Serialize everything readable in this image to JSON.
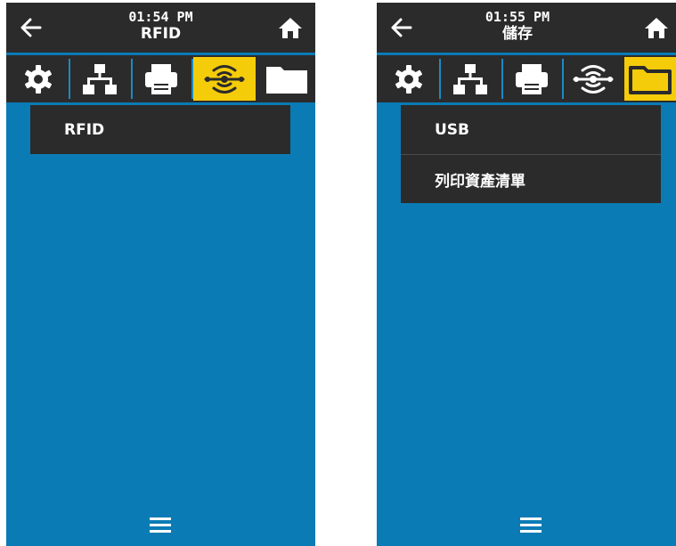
{
  "screens": [
    {
      "time": "01:54 PM",
      "title": "RFID",
      "active_tab": "rfid",
      "menu_items": [
        "RFID"
      ]
    },
    {
      "time": "01:55 PM",
      "title": "儲存",
      "active_tab": "storage",
      "menu_items": [
        "USB",
        "列印資產清單"
      ]
    }
  ],
  "colors": {
    "background_blue": "#0a7bb5",
    "bar_dark": "#2b2b2b",
    "active_tab_yellow": "#f5cc0a"
  },
  "icons": {
    "back": "left-arrow-icon",
    "home": "home-icon",
    "tabs": [
      "gear-icon",
      "network-icon",
      "printer-icon",
      "rfid-icon",
      "folder-icon"
    ],
    "menu": "hamburger-menu-icon"
  }
}
